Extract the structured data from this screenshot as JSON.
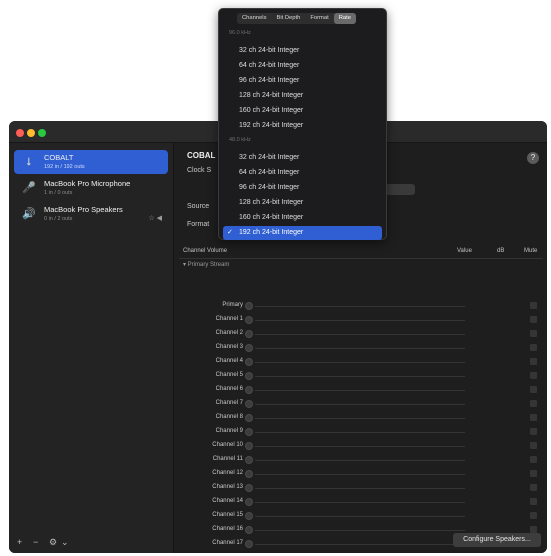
{
  "sidebar": {
    "devices": [
      {
        "name": "COBALT",
        "subtitle": "192 in / 192 outs",
        "icon": "usb-icon",
        "selected": true
      },
      {
        "name": "MacBook Pro Microphone",
        "subtitle": "1 in / 0 outs",
        "icon": "microphone-icon",
        "selected": false
      },
      {
        "name": "MacBook Pro Speakers",
        "subtitle": "0 in / 2 outs",
        "icon": "speaker-icon",
        "selected": false,
        "badges": "☆ ◀"
      }
    ],
    "footer": {
      "add": "+",
      "remove": "−",
      "gear": "⚙",
      "chevron": "⌄"
    }
  },
  "main": {
    "device_title": "COBAL",
    "clock_label": "Clock S",
    "source_label": "Source",
    "format_label": "Format",
    "help": "?",
    "table_headers": {
      "channel_volume": "Channel Volume",
      "value": "Value",
      "db": "dB",
      "mute": "Mute"
    },
    "stream_label": "▾ Primary Stream",
    "channels": [
      "Primary",
      "Channel 1",
      "Channel 2",
      "Channel 3",
      "Channel 4",
      "Channel 5",
      "Channel 6",
      "Channel 7",
      "Channel 8",
      "Channel 9",
      "Channel 10",
      "Channel 11",
      "Channel 12",
      "Channel 13",
      "Channel 14",
      "Channel 15",
      "Channel 16",
      "Channel 17"
    ],
    "configure_button": "Configure Speakers..."
  },
  "popup": {
    "tabs": [
      "Channels",
      "Bit Depth",
      "Format",
      "Rate"
    ],
    "active_tab": 3,
    "groups": [
      {
        "label": "96.0 kHz",
        "options": [
          "32 ch 24-bit Integer",
          "64 ch 24-bit Integer",
          "96 ch 24-bit Integer",
          "128 ch 24-bit Integer",
          "160 ch 24-bit Integer",
          "192 ch 24-bit Integer"
        ]
      },
      {
        "label": "48.0 kHz",
        "options": [
          "32 ch 24-bit Integer",
          "64 ch 24-bit Integer",
          "96 ch 24-bit Integer",
          "128 ch 24-bit Integer",
          "160 ch 24-bit Integer",
          "192 ch 24-bit Integer"
        ]
      }
    ],
    "selected": {
      "group": 1,
      "option": 5
    },
    "checkmark": "✓"
  },
  "colors": {
    "accent": "#2f5fd3",
    "window": "#1e1e1e",
    "sidebar": "#232323"
  }
}
